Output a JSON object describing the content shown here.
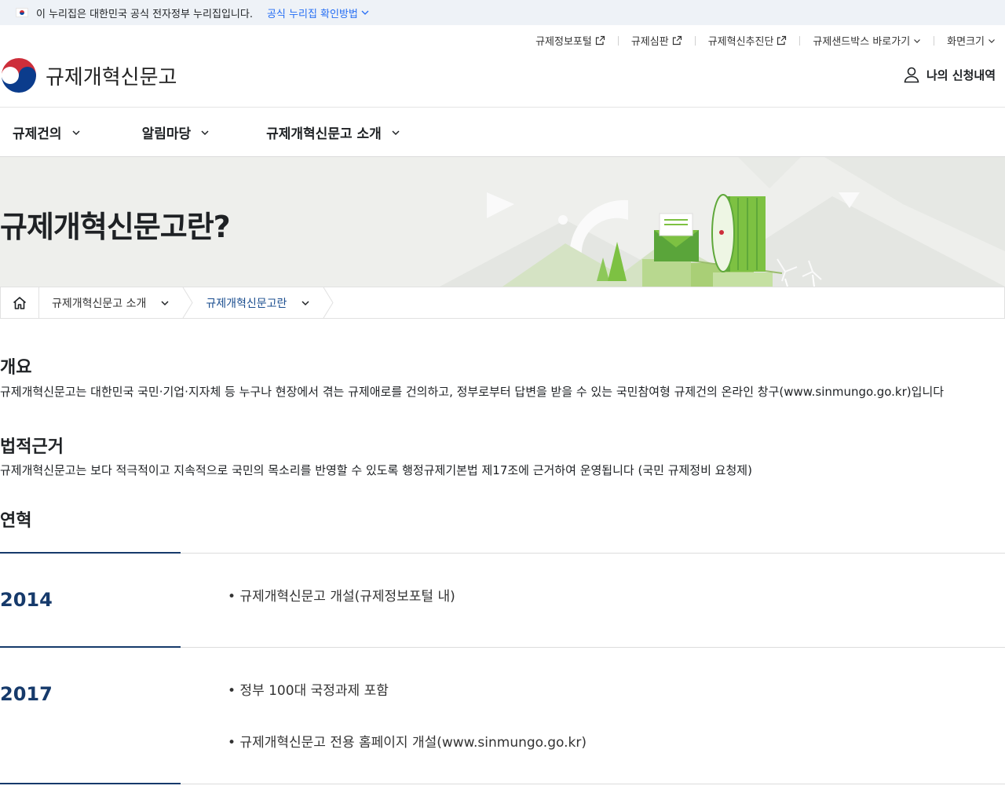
{
  "gov_banner": {
    "text": "이 누리집은 대한민국 공식 전자정부 누리집입니다.",
    "link": "공식 누리집 확인방법"
  },
  "utility": {
    "items": [
      "규제정보포털",
      "규제심판",
      "규제혁신추진단",
      "규제샌드박스 바로가기",
      "화면크기"
    ]
  },
  "header": {
    "site_title": "규제개혁신문고",
    "my_apply": "나의 신청내역"
  },
  "gnb": {
    "menus": [
      "규제건의",
      "알림마당",
      "규제개혁신문고 소개"
    ]
  },
  "hero": {
    "title": "규제개혁신문고란?"
  },
  "breadcrumb": {
    "items": [
      "규제개혁신문고 소개",
      "규제개혁신문고란"
    ]
  },
  "sections": {
    "overview": {
      "title": "개요",
      "text": "규제개혁신문고는 대한민국 국민·기업·지자체 등 누구나 현장에서 겪는 규제애로를 건의하고, 정부로부터 답변을 받을 수 있는 국민참여형 규제건의 온라인 창구(www.sinmungo.go.kr)입니다"
    },
    "legal": {
      "title": "법적근거",
      "text": "규제개혁신문고는 보다 적극적이고 지속적으로 국민의 목소리를 반영할 수 있도록 행정규제기본법 제17조에 근거하여 운영됩니다 (국민 규제정비 요청제)"
    },
    "history": {
      "title": "연혁",
      "entries": [
        {
          "year": "2014",
          "items": [
            "• 규제개혁신문고 개설(규제정보포털 내)"
          ]
        },
        {
          "year": "2017",
          "items": [
            "• 정부 100대 국정과제 포함",
            "• 규제개혁신문고 전용 홈페이지 개설(www.sinmungo.go.kr)"
          ]
        }
      ]
    }
  },
  "colors": {
    "accent_navy": "#163a6b",
    "link_blue": "#256ef4",
    "hero_bg": "#eeefec",
    "green": "#7dc142"
  },
  "icons": [
    "flag-icon",
    "chevron-down-icon",
    "external-link-icon",
    "gov-logo-icon",
    "user-icon",
    "home-icon"
  ]
}
